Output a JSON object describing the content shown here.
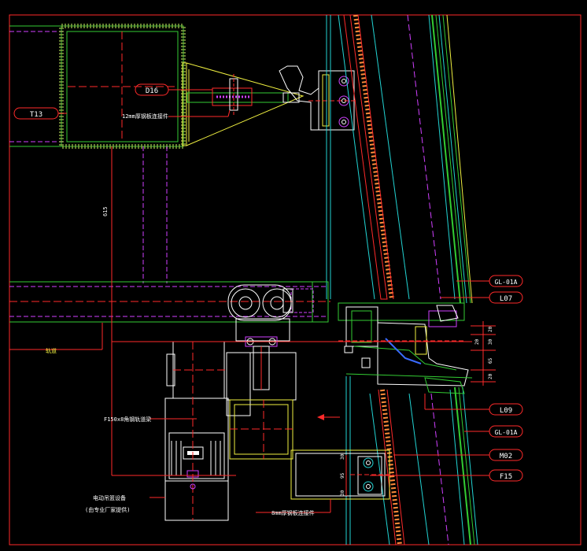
{
  "drawing": {
    "colors": {
      "background": "#000000",
      "frame": "#ff2a2a",
      "steel": "#33cc33",
      "glass_cyan": "#22d3d3",
      "yellow": "#f0f040",
      "magenta": "#d040ff",
      "white": "#ffffff",
      "orange": "#ff8c3a",
      "blue": "#3a6bff"
    },
    "tags": {
      "t13": "T13",
      "d16": "D16",
      "gl01a_top": "GL-01A",
      "l07": "L07",
      "l09": "L09",
      "gl01a_bottom": "GL-01A",
      "m02": "M02",
      "f15": "F15"
    },
    "notes": {
      "plate_12mm": "12mm厚钢板连接件",
      "rail_label": "轨道",
      "beam_label": "F150x8角钢轨道梁",
      "motor_label_1": "电动吊篮设备",
      "motor_label_2": "(由专业厂家提供)",
      "plate_8mm": "8mm厚钢板连接件",
      "vertical_dim": "615",
      "dim_20a": "20",
      "dim_30": "30",
      "dim_20b": "20",
      "dim_65": "65",
      "dim_20c": "20",
      "box_dim_top": "30",
      "box_dim_mid": "95",
      "box_dim_bot": "30"
    }
  }
}
